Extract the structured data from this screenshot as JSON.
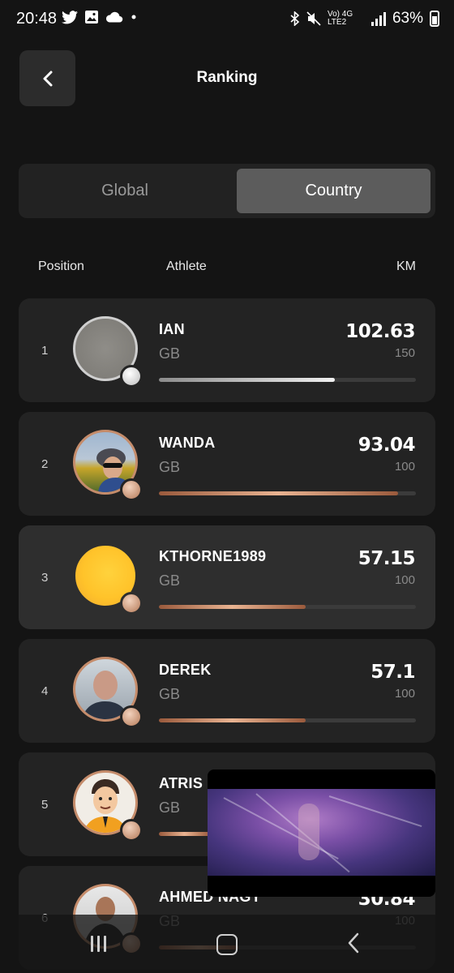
{
  "status_bar": {
    "time": "20:48",
    "left_icons": [
      "twitter-icon",
      "image-icon",
      "cloud-icon",
      "dot-icon"
    ],
    "network_text": "Vo) 4G LTE2",
    "battery": "63%"
  },
  "header": {
    "title": "Ranking",
    "back_icon": "chevron-left-icon"
  },
  "tabs": {
    "global": "Global",
    "country": "Country",
    "selected": "country"
  },
  "columns": {
    "position": "Position",
    "athlete": "Athlete",
    "km": "KM"
  },
  "rankings": [
    {
      "position": "1",
      "name": "IAN",
      "country": "GB",
      "km": "102.63",
      "target": "150",
      "progress": 0.684,
      "medal": "silver",
      "avatar": "grey-placeholder"
    },
    {
      "position": "2",
      "name": "WANDA",
      "country": "GB",
      "km": "93.04",
      "target": "100",
      "progress": 0.93,
      "medal": "bronze",
      "avatar": "cyclist-photo"
    },
    {
      "position": "3",
      "name": "KTHORNE1989",
      "country": "GB",
      "km": "57.15",
      "target": "100",
      "progress": 0.57,
      "medal": "bronze",
      "avatar": "yellow-placeholder"
    },
    {
      "position": "4",
      "name": "DEREK",
      "country": "GB",
      "km": "57.1",
      "target": "100",
      "progress": 0.57,
      "medal": "bronze",
      "avatar": "man-photo"
    },
    {
      "position": "5",
      "name": "ATRIS",
      "country": "GB",
      "km": "",
      "target": "",
      "progress": 0.2,
      "medal": "bronze",
      "avatar": "cartoon-avatar"
    },
    {
      "position": "6",
      "name": "AHMED NAGY",
      "country": "GB",
      "km": "30.84",
      "target": "100",
      "progress": 0.31,
      "medal": "bronze",
      "avatar": "man-photo-2"
    }
  ],
  "colors": {
    "background": "#141414",
    "card": "#232323",
    "silver": "#cfcfcf",
    "bronze": "#c58c6b"
  },
  "navigation": {
    "recents": "recents-icon",
    "home": "home-icon",
    "back": "back-icon"
  }
}
